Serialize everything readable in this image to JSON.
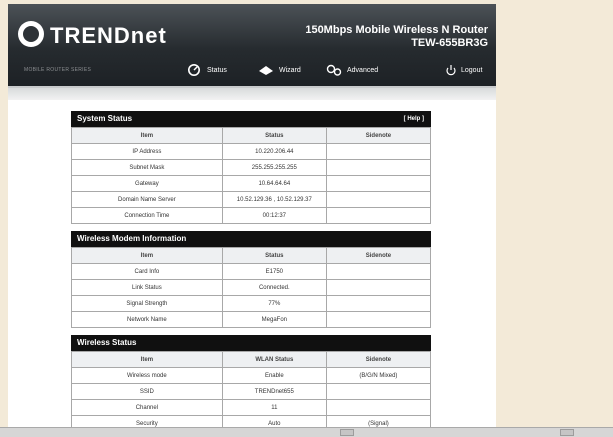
{
  "header": {
    "logo": "TRENDnet",
    "product_line1": "150Mbps Mobile Wireless N Router",
    "product_line2": "TEW-655BR3G",
    "left_text": "MOBILE ROUTER SERIES",
    "nav": [
      {
        "label": "Status",
        "icon": "status-icon"
      },
      {
        "label": "Wizard",
        "icon": "wizard-icon"
      },
      {
        "label": "Advanced",
        "icon": "advanced-icon"
      }
    ],
    "logout": "Logout"
  },
  "system_status": {
    "title": "System Status",
    "help": "[ Help ]",
    "headers": [
      "Item",
      "Status",
      "Sidenote"
    ],
    "rows": [
      {
        "item": "IP Address",
        "status": "10.220.206.44",
        "note": ""
      },
      {
        "item": "Subnet Mask",
        "status": "255.255.255.255",
        "note": ""
      },
      {
        "item": "Gateway",
        "status": "10.64.64.64",
        "note": ""
      },
      {
        "item": "Domain Name Server",
        "status": "10.52.129.36 , 10.52.129.37",
        "note": ""
      },
      {
        "item": "Connection Time",
        "status": "00:12:37",
        "note": ""
      }
    ]
  },
  "wireless_modem": {
    "title": "Wireless Modem Information",
    "headers": [
      "Item",
      "Status",
      "Sidenote"
    ],
    "rows": [
      {
        "item": "Card Info",
        "status": "E1750",
        "note": ""
      },
      {
        "item": "Link Status",
        "status": "Connected.",
        "note": ""
      },
      {
        "item": "Signal Strength",
        "status": "77%",
        "note": ""
      },
      {
        "item": "Network Name",
        "status": "MegaFon",
        "note": ""
      }
    ]
  },
  "wireless_status": {
    "title": "Wireless Status",
    "headers": [
      "Item",
      "WLAN Status",
      "Sidenote"
    ],
    "rows": [
      {
        "item": "Wireless mode",
        "status": "Enable",
        "note": "(B/G/N Mixed)"
      },
      {
        "item": "SSID",
        "status": "TRENDnet655",
        "note": ""
      },
      {
        "item": "Channel",
        "status": "11",
        "note": ""
      },
      {
        "item": "Security",
        "status": "Auto",
        "note": "(Signal)"
      }
    ]
  }
}
